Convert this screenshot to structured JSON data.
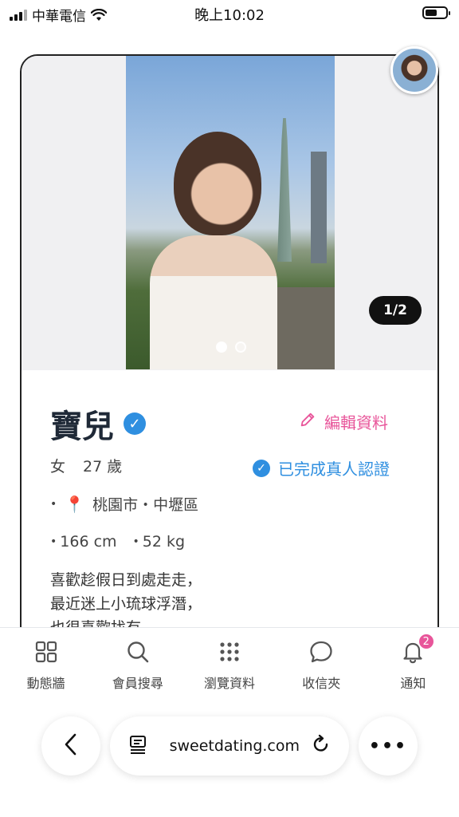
{
  "status_bar": {
    "carrier": "中華電信",
    "time": "晚上10:02"
  },
  "profile": {
    "photo_counter": "1/2",
    "photo_index": 1,
    "photo_total": 2,
    "name": "寶兒",
    "edit_label": "編輯資料",
    "gender": "女",
    "age": "27 歲",
    "certified_label": "已完成真人認證",
    "location": "桃園市・中壢區",
    "height": "166 cm",
    "weight": "52 kg",
    "bio": "喜歡趁假日到處走走，最近迷上小琉球浮潛，也很喜歡找有"
  },
  "bottom_nav": {
    "items": [
      {
        "label": "動態牆",
        "icon": "grid-icon"
      },
      {
        "label": "會員搜尋",
        "icon": "search-icon"
      },
      {
        "label": "瀏覽資料",
        "icon": "dots-grid-icon"
      },
      {
        "label": "收信夾",
        "icon": "chat-bubble-icon"
      },
      {
        "label": "通知",
        "icon": "bell-icon",
        "badge": "2"
      }
    ]
  },
  "browser": {
    "url": "sweetdating.com"
  },
  "colors": {
    "accent_pink": "#e8559a",
    "verify_blue": "#2f8fe0"
  }
}
